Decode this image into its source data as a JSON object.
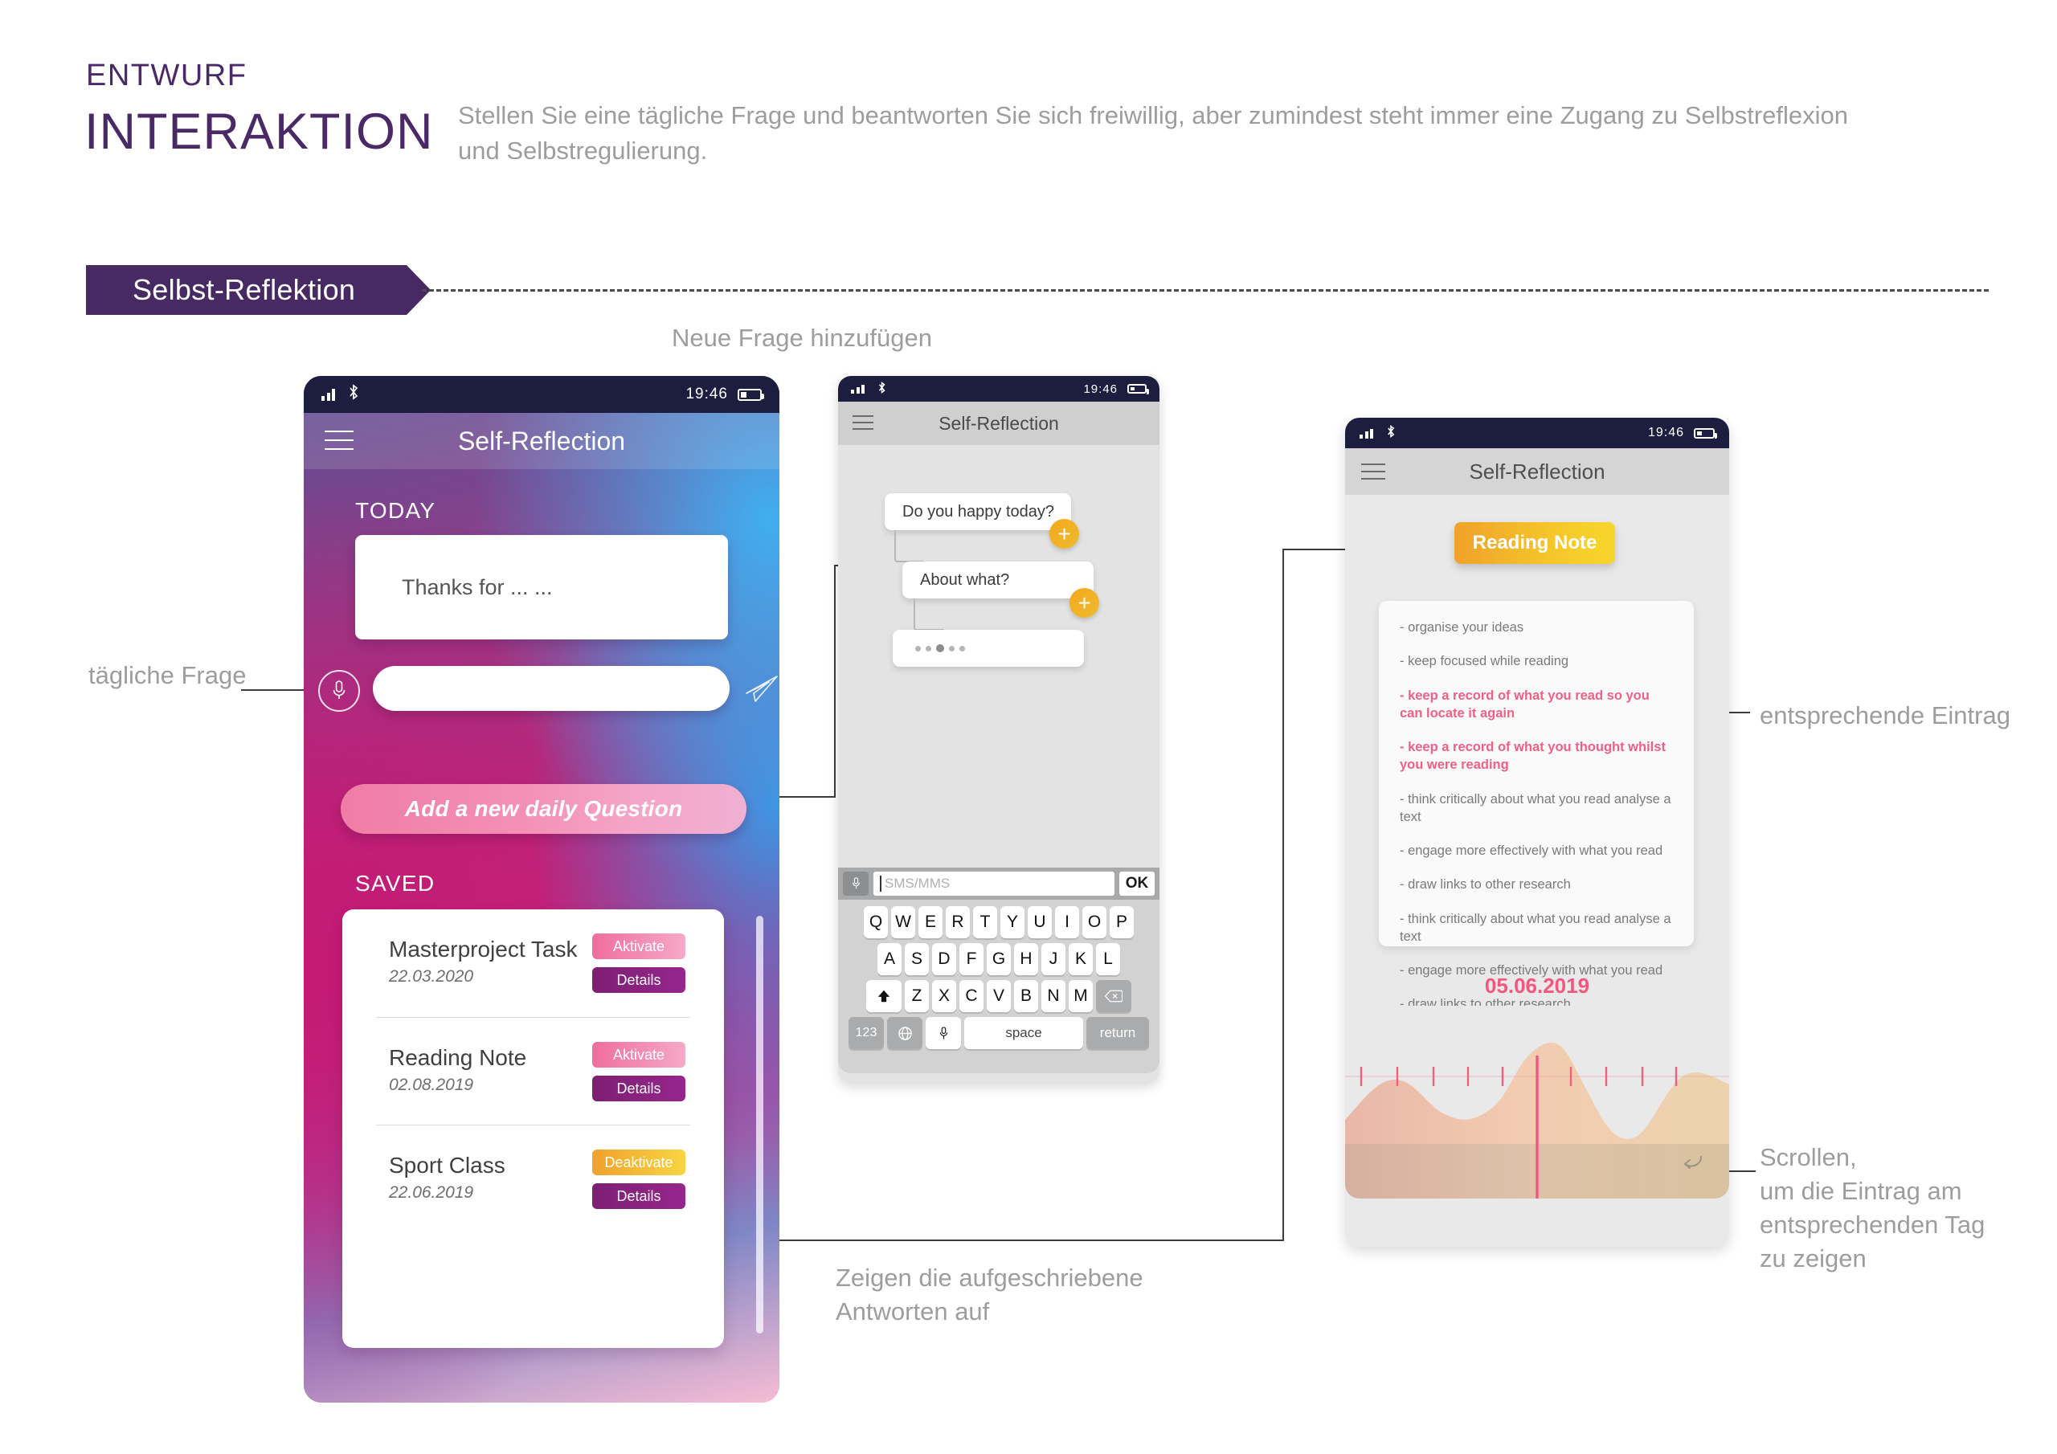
{
  "header": {
    "kicker": "ENTWURF",
    "title": "INTERAKTION",
    "subtitle": "Stellen Sie eine tägliche Frage und beantworten Sie sich freiwillig, aber zumindest steht immer eine Zugang zu Selbstreflexion und Selbstregulierung."
  },
  "section": {
    "banner_label": "Selbst-Reflektion"
  },
  "captions": {
    "new_question": "Neue Frage hinzufügen",
    "daily_question": "tägliche Frage",
    "show_answers_line1": "Zeigen die aufgeschriebene",
    "show_answers_line2": "Antworten auf",
    "corresponding_entry": "entsprechende Eintrag",
    "scroll_line1": "Scrollen,",
    "scroll_line2": "um die Eintrag am",
    "scroll_line3": "entsprechenden Tag",
    "scroll_line4": "zu zeigen"
  },
  "colors": {
    "brand_purple": "#472a63",
    "accent_pink": "#ef5f86",
    "accent_yellow": "#f3c02a",
    "details_purple": "#7d1f72",
    "muted_grey": "#9d9d9e"
  },
  "phone1": {
    "status": {
      "time": "19:46",
      "signal_icon": "signal-bars-icon",
      "bluetooth_icon": "bluetooth-icon",
      "battery_icon": "battery-icon"
    },
    "nav": {
      "menu_icon": "hamburger-menu-icon",
      "title": "Self-Reflection"
    },
    "today_label": "TODAY",
    "today_card_text": "Thanks for ... ...",
    "mic_icon": "microphone-icon",
    "send_icon": "send-paper-plane-icon",
    "answer_input_value": "",
    "answer_input_placeholder": "",
    "add_button_label": "Add a new daily Question",
    "saved_label": "SAVED",
    "saved_items": [
      {
        "title": "Masterproject Task",
        "date": "22.03.2020",
        "toggle_label": "Aktivate",
        "toggle_state": "inactive",
        "details_label": "Details"
      },
      {
        "title": "Reading Note",
        "date": "02.08.2019",
        "toggle_label": "Aktivate",
        "toggle_state": "inactive",
        "details_label": "Details"
      },
      {
        "title": "Sport Class",
        "date": "22.06.2019",
        "toggle_label": "Deaktivate",
        "toggle_state": "active",
        "details_label": "Details"
      }
    ]
  },
  "phone2": {
    "status": {
      "time": "19:46"
    },
    "nav": {
      "menu_icon": "hamburger-menu-icon",
      "title": "Self-Reflection"
    },
    "bubbles": [
      {
        "text": "Do you happy today?",
        "has_plus": true,
        "plus_label": "+"
      },
      {
        "text": "About what?",
        "has_plus": true,
        "plus_label": "+"
      },
      {
        "text": "",
        "has_plus": false,
        "is_typing": true
      }
    ],
    "input": {
      "mic_icon": "microphone-icon",
      "placeholder": "SMS/MMS",
      "value": "",
      "ok_label": "OK"
    },
    "keyboard": {
      "row1": [
        "Q",
        "W",
        "E",
        "R",
        "T",
        "Y",
        "U",
        "I",
        "O",
        "P"
      ],
      "row2": [
        "A",
        "S",
        "D",
        "F",
        "G",
        "H",
        "J",
        "K",
        "L"
      ],
      "row3": [
        "Z",
        "X",
        "C",
        "V",
        "B",
        "N",
        "M"
      ],
      "shift_icon": "shift-arrow-icon",
      "backspace_icon": "backspace-icon",
      "numbers_label": "123",
      "globe_icon": "globe-icon",
      "voice_icon": "microphone-icon",
      "space_label": "space",
      "return_label": "return"
    }
  },
  "phone3": {
    "status": {
      "time": "19:46"
    },
    "nav": {
      "menu_icon": "hamburger-menu-icon",
      "title": "Self-Reflection"
    },
    "tag_label": "Reading Note",
    "notes": [
      {
        "text": "- organise your ideas",
        "highlight": false
      },
      {
        "text": "- keep focused while reading",
        "highlight": false
      },
      {
        "text": "- keep a record of what you read so you can locate it again",
        "highlight": true
      },
      {
        "text": "- keep a record of what you thought whilst you were reading",
        "highlight": true
      },
      {
        "text": "- think critically about what you read analyse a text",
        "highlight": false
      },
      {
        "text": "- engage more effectively with what you read",
        "highlight": false
      },
      {
        "text": "- draw links to other research",
        "highlight": false
      },
      {
        "text": "- think critically about what you read analyse a text",
        "highlight": false
      },
      {
        "text": "- engage more effectively with what you read",
        "highlight": false
      },
      {
        "text": "- draw links to other research",
        "highlight": false
      }
    ],
    "timeline_date": "05.06.2019",
    "undo_icon": "undo-arrow-icon",
    "chart_data": {
      "type": "area",
      "title": "05.06.2019",
      "xlabel": "",
      "ylabel": "",
      "x": [
        0,
        1,
        2,
        3,
        4,
        5,
        6,
        7,
        8,
        9,
        10,
        11,
        12
      ],
      "values": [
        48,
        62,
        55,
        38,
        36,
        45,
        72,
        96,
        84,
        44,
        26,
        40,
        78
      ],
      "ylim": [
        0,
        100
      ],
      "tick_count": 9,
      "marker_position_x": 6.1,
      "marker_label": "05.06.2019",
      "grid": false,
      "legend": "none"
    }
  }
}
